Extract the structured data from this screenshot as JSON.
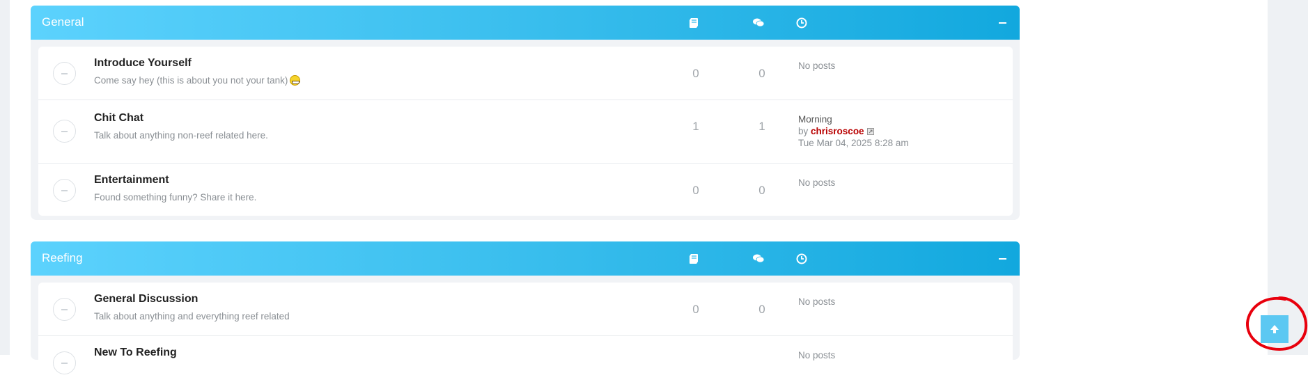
{
  "colors": {
    "header_gradient_start": "#5cd2fd",
    "header_gradient_end": "#12a8de",
    "author_link": "#b80000",
    "back_to_top_bg": "#5cc8f2",
    "annotation_ring": "#e8000d"
  },
  "header_icons": {
    "topics": "book-icon",
    "posts": "comments-icon",
    "last_post": "clock-icon",
    "collapse": "minus-icon"
  },
  "categories": [
    {
      "title": "General",
      "forums": [
        {
          "title": "Introduce Yourself",
          "description": "Come say hey (this is about you not your tank)",
          "topics": "0",
          "posts": "0",
          "last_post": "No posts"
        },
        {
          "title": "Chit Chat",
          "description": "Talk about anything non-reef related here.",
          "topics": "1",
          "posts": "1",
          "last_post_subject": "Morning",
          "by": "by",
          "last_post_author": "chrisroscoe",
          "last_post_time": "Tue Mar 04, 2025 8:28 am"
        },
        {
          "title": "Entertainment",
          "description": "Found something funny? Share it here.",
          "topics": "0",
          "posts": "0",
          "last_post": "No posts"
        }
      ]
    },
    {
      "title": "Reefing",
      "forums": [
        {
          "title": "General Discussion",
          "description": "Talk about anything and everything reef related",
          "topics": "0",
          "posts": "0",
          "last_post": "No posts"
        },
        {
          "title": "New To Reefing",
          "description": "",
          "topics": "",
          "posts": "",
          "last_post": "No posts"
        }
      ]
    }
  ]
}
